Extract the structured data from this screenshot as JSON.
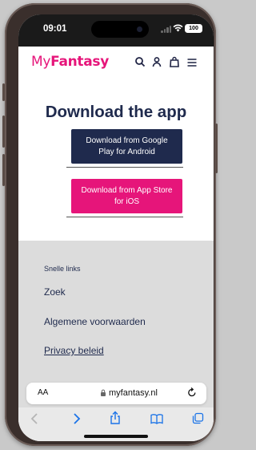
{
  "status_bar": {
    "time": "09:01",
    "battery": "100"
  },
  "header": {
    "logo_prefix": "My",
    "logo_brand": "Fantasy",
    "icons": [
      "search-icon",
      "account-icon",
      "bag-icon",
      "menu-icon"
    ]
  },
  "main": {
    "title": "Download the app",
    "google_button": "Download from Google Play for Android",
    "ios_button": "Download from App Store for iOS"
  },
  "footer": {
    "section_label": "Snelle links",
    "links": [
      "Zoek",
      "Algemene voorwaarden",
      "Privacy beleid"
    ]
  },
  "browser": {
    "text_size_label": "AA",
    "domain": "myfantasy.nl",
    "toolbar_icons": [
      "back-icon",
      "forward-icon",
      "share-icon",
      "bookmarks-icon",
      "tabs-icon"
    ]
  },
  "colors": {
    "brand_pink": "#e6157a",
    "brand_navy": "#1f2a4d",
    "link_blue": "#1a73e8"
  }
}
